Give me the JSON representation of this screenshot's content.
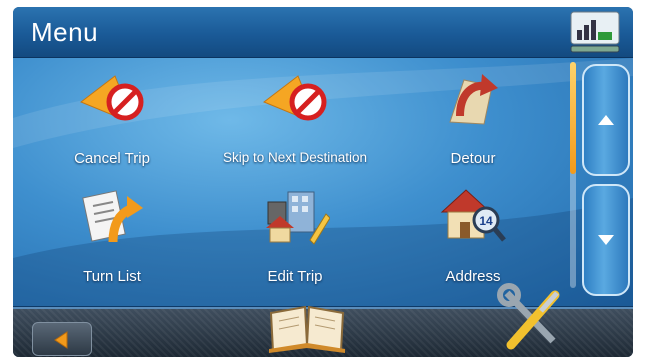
{
  "header": {
    "title": "Menu",
    "signal_icon": "signal-strength-icon"
  },
  "menu": {
    "items": [
      {
        "label": "Cancel Trip",
        "icon": "cancel-trip-icon"
      },
      {
        "label": "Skip to Next Destination",
        "icon": "skip-destination-icon"
      },
      {
        "label": "Detour",
        "icon": "detour-icon"
      },
      {
        "label": "Turn List",
        "icon": "turn-list-icon"
      },
      {
        "label": "Edit Trip",
        "icon": "edit-trip-icon"
      },
      {
        "label": "Address",
        "icon": "address-icon"
      }
    ],
    "address_badge": "14"
  },
  "scroll": {
    "up_icon": "up-arrow-icon",
    "down_icon": "down-arrow-icon"
  },
  "footer": {
    "back_icon": "back-arrow-icon",
    "book_icon": "address-book-icon",
    "tools_icon": "tools-icon"
  },
  "colors": {
    "accent": "#f29a1b",
    "header": "#1a5a97",
    "main": "#3e8fce",
    "stop_red": "#d62020"
  }
}
